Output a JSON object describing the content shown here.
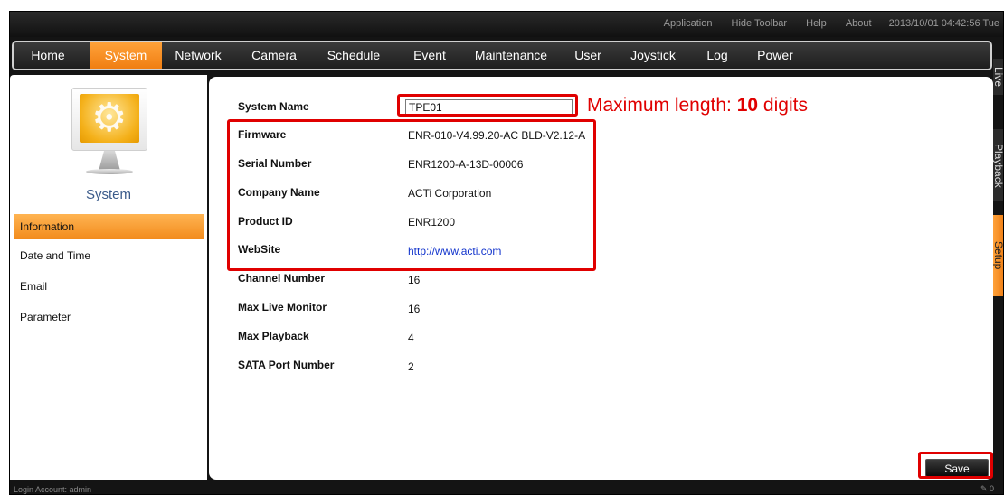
{
  "toolbar": {
    "links": [
      "Application",
      "Hide Toolbar",
      "Help",
      "About"
    ],
    "datetime": "2013/10/01 04:42:56 Tue"
  },
  "menu": {
    "items": [
      "Home",
      "System",
      "Network",
      "Camera",
      "Schedule",
      "Event",
      "Maintenance",
      "User",
      "Joystick",
      "Log",
      "Power"
    ],
    "active": "System"
  },
  "side_tabs": [
    "Live",
    "Playback",
    "Setup"
  ],
  "left": {
    "section_title": "System",
    "nav": [
      "Information",
      "Date and Time",
      "Email",
      "Parameter"
    ],
    "active": "Information"
  },
  "form": {
    "system_name_label": "System Name",
    "system_name_value": "TPE01",
    "fields": [
      {
        "label": "Firmware",
        "value": "ENR-010-V4.99.20-AC BLD-V2.12-A"
      },
      {
        "label": "Serial Number",
        "value": "ENR1200-A-13D-00006"
      },
      {
        "label": "Company Name",
        "value": "ACTi Corporation"
      },
      {
        "label": "Product ID",
        "value": "ENR1200"
      },
      {
        "label": "WebSite",
        "value": "http://www.acti.com"
      },
      {
        "label": "Channel Number",
        "value": "16"
      },
      {
        "label": "Max Live Monitor",
        "value": "16"
      },
      {
        "label": "Max Playback",
        "value": "4"
      },
      {
        "label": "SATA Port Number",
        "value": "2"
      }
    ]
  },
  "annotation": {
    "prefix": "Maximum length: ",
    "number": "10",
    "suffix": " digits",
    "color": "#e00000"
  },
  "save_label": "Save",
  "status": {
    "login": "Login Account: admin",
    "signal": "0"
  },
  "colors": {
    "accent": "#f28b1c",
    "frame": "#141414",
    "link": "#1133cc"
  }
}
